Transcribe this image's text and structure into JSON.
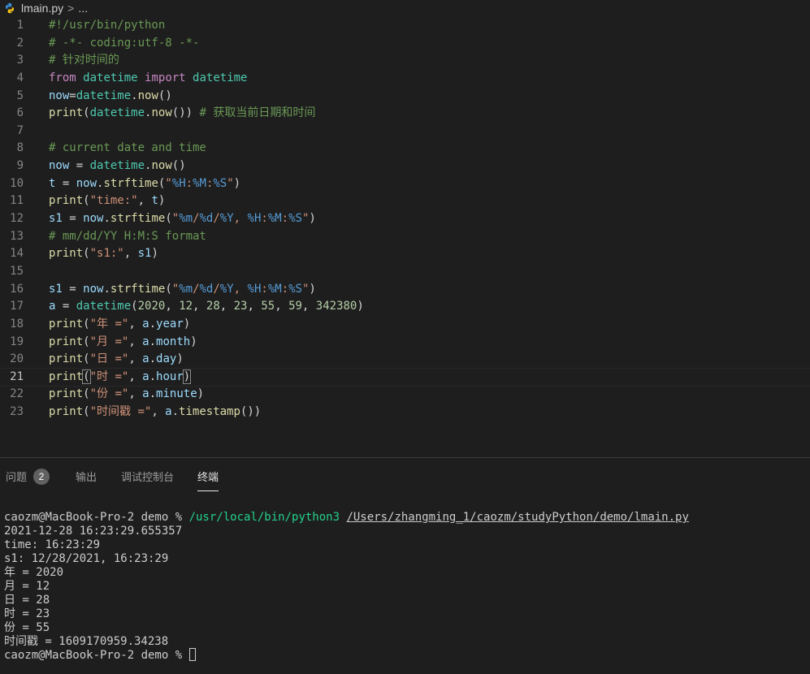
{
  "breadcrumb": {
    "file": "lmain.py",
    "separator": ">",
    "more": "..."
  },
  "editor": {
    "active_line": 21,
    "lines": [
      {
        "n": "1",
        "tokens": [
          {
            "t": "#!/usr/bin/python",
            "c": "cm"
          }
        ]
      },
      {
        "n": "2",
        "tokens": [
          {
            "t": "# -*- coding:utf-8 -*-",
            "c": "cm"
          }
        ]
      },
      {
        "n": "3",
        "tokens": [
          {
            "t": "# 针对时间的",
            "c": "cm"
          }
        ]
      },
      {
        "n": "4",
        "tokens": [
          {
            "t": "from",
            "c": "kw"
          },
          {
            "t": " ",
            "c": "pun"
          },
          {
            "t": "datetime",
            "c": "cls"
          },
          {
            "t": " ",
            "c": "pun"
          },
          {
            "t": "import",
            "c": "kw"
          },
          {
            "t": " ",
            "c": "pun"
          },
          {
            "t": "datetime",
            "c": "cls"
          }
        ]
      },
      {
        "n": "5",
        "tokens": [
          {
            "t": "now",
            "c": "var"
          },
          {
            "t": "=",
            "c": "pun"
          },
          {
            "t": "datetime",
            "c": "cls"
          },
          {
            "t": ".",
            "c": "pun"
          },
          {
            "t": "now",
            "c": "fn"
          },
          {
            "t": "()",
            "c": "pun"
          }
        ]
      },
      {
        "n": "6",
        "tokens": [
          {
            "t": "print",
            "c": "fn"
          },
          {
            "t": "(",
            "c": "pun"
          },
          {
            "t": "datetime",
            "c": "cls"
          },
          {
            "t": ".",
            "c": "pun"
          },
          {
            "t": "now",
            "c": "fn"
          },
          {
            "t": "()) ",
            "c": "pun"
          },
          {
            "t": "# 获取当前日期和时间",
            "c": "cm"
          }
        ]
      },
      {
        "n": "7",
        "tokens": []
      },
      {
        "n": "8",
        "tokens": [
          {
            "t": "# current date and time",
            "c": "cm"
          }
        ]
      },
      {
        "n": "9",
        "tokens": [
          {
            "t": "now",
            "c": "var"
          },
          {
            "t": " = ",
            "c": "pun"
          },
          {
            "t": "datetime",
            "c": "cls"
          },
          {
            "t": ".",
            "c": "pun"
          },
          {
            "t": "now",
            "c": "fn"
          },
          {
            "t": "()",
            "c": "pun"
          }
        ]
      },
      {
        "n": "10",
        "tokens": [
          {
            "t": "t",
            "c": "var"
          },
          {
            "t": " = ",
            "c": "pun"
          },
          {
            "t": "now",
            "c": "var"
          },
          {
            "t": ".",
            "c": "pun"
          },
          {
            "t": "strftime",
            "c": "fn"
          },
          {
            "t": "(",
            "c": "pun"
          },
          {
            "t": "\"",
            "c": "str"
          },
          {
            "t": "%H",
            "c": "fmt"
          },
          {
            "t": ":",
            "c": "str"
          },
          {
            "t": "%M",
            "c": "fmt"
          },
          {
            "t": ":",
            "c": "str"
          },
          {
            "t": "%S",
            "c": "fmt"
          },
          {
            "t": "\"",
            "c": "str"
          },
          {
            "t": ")",
            "c": "pun"
          }
        ]
      },
      {
        "n": "11",
        "tokens": [
          {
            "t": "print",
            "c": "fn"
          },
          {
            "t": "(",
            "c": "pun"
          },
          {
            "t": "\"time:\"",
            "c": "str"
          },
          {
            "t": ", ",
            "c": "pun"
          },
          {
            "t": "t",
            "c": "var"
          },
          {
            "t": ")",
            "c": "pun"
          }
        ]
      },
      {
        "n": "12",
        "tokens": [
          {
            "t": "s1",
            "c": "var"
          },
          {
            "t": " = ",
            "c": "pun"
          },
          {
            "t": "now",
            "c": "var"
          },
          {
            "t": ".",
            "c": "pun"
          },
          {
            "t": "strftime",
            "c": "fn"
          },
          {
            "t": "(",
            "c": "pun"
          },
          {
            "t": "\"",
            "c": "str"
          },
          {
            "t": "%m",
            "c": "fmt"
          },
          {
            "t": "/",
            "c": "str"
          },
          {
            "t": "%d",
            "c": "fmt"
          },
          {
            "t": "/",
            "c": "str"
          },
          {
            "t": "%Y",
            "c": "fmt"
          },
          {
            "t": ", ",
            "c": "str"
          },
          {
            "t": "%H",
            "c": "fmt"
          },
          {
            "t": ":",
            "c": "str"
          },
          {
            "t": "%M",
            "c": "fmt"
          },
          {
            "t": ":",
            "c": "str"
          },
          {
            "t": "%S",
            "c": "fmt"
          },
          {
            "t": "\"",
            "c": "str"
          },
          {
            "t": ")",
            "c": "pun"
          }
        ]
      },
      {
        "n": "13",
        "tokens": [
          {
            "t": "# mm/dd/YY H:M:S format",
            "c": "cm"
          }
        ]
      },
      {
        "n": "14",
        "tokens": [
          {
            "t": "print",
            "c": "fn"
          },
          {
            "t": "(",
            "c": "pun"
          },
          {
            "t": "\"s1:\"",
            "c": "str"
          },
          {
            "t": ", ",
            "c": "pun"
          },
          {
            "t": "s1",
            "c": "var"
          },
          {
            "t": ")",
            "c": "pun"
          }
        ]
      },
      {
        "n": "15",
        "tokens": []
      },
      {
        "n": "16",
        "tokens": [
          {
            "t": "s1",
            "c": "var"
          },
          {
            "t": " = ",
            "c": "pun"
          },
          {
            "t": "now",
            "c": "var"
          },
          {
            "t": ".",
            "c": "pun"
          },
          {
            "t": "strftime",
            "c": "fn"
          },
          {
            "t": "(",
            "c": "pun"
          },
          {
            "t": "\"",
            "c": "str"
          },
          {
            "t": "%m",
            "c": "fmt"
          },
          {
            "t": "/",
            "c": "str"
          },
          {
            "t": "%d",
            "c": "fmt"
          },
          {
            "t": "/",
            "c": "str"
          },
          {
            "t": "%Y",
            "c": "fmt"
          },
          {
            "t": ", ",
            "c": "str"
          },
          {
            "t": "%H",
            "c": "fmt"
          },
          {
            "t": ":",
            "c": "str"
          },
          {
            "t": "%M",
            "c": "fmt"
          },
          {
            "t": ":",
            "c": "str"
          },
          {
            "t": "%S",
            "c": "fmt"
          },
          {
            "t": "\"",
            "c": "str"
          },
          {
            "t": ")",
            "c": "pun"
          }
        ]
      },
      {
        "n": "17",
        "tokens": [
          {
            "t": "a",
            "c": "var"
          },
          {
            "t": " = ",
            "c": "pun"
          },
          {
            "t": "datetime",
            "c": "cls"
          },
          {
            "t": "(",
            "c": "pun"
          },
          {
            "t": "2020",
            "c": "num"
          },
          {
            "t": ", ",
            "c": "pun"
          },
          {
            "t": "12",
            "c": "num"
          },
          {
            "t": ", ",
            "c": "pun"
          },
          {
            "t": "28",
            "c": "num"
          },
          {
            "t": ", ",
            "c": "pun"
          },
          {
            "t": "23",
            "c": "num"
          },
          {
            "t": ", ",
            "c": "pun"
          },
          {
            "t": "55",
            "c": "num"
          },
          {
            "t": ", ",
            "c": "pun"
          },
          {
            "t": "59",
            "c": "num"
          },
          {
            "t": ", ",
            "c": "pun"
          },
          {
            "t": "342380",
            "c": "num"
          },
          {
            "t": ")",
            "c": "pun"
          }
        ]
      },
      {
        "n": "18",
        "tokens": [
          {
            "t": "print",
            "c": "fn"
          },
          {
            "t": "(",
            "c": "pun"
          },
          {
            "t": "\"年 =\"",
            "c": "str"
          },
          {
            "t": ", ",
            "c": "pun"
          },
          {
            "t": "a",
            "c": "var"
          },
          {
            "t": ".",
            "c": "pun"
          },
          {
            "t": "year",
            "c": "var"
          },
          {
            "t": ")",
            "c": "pun"
          }
        ]
      },
      {
        "n": "19",
        "tokens": [
          {
            "t": "print",
            "c": "fn"
          },
          {
            "t": "(",
            "c": "pun"
          },
          {
            "t": "\"月 =\"",
            "c": "str"
          },
          {
            "t": ", ",
            "c": "pun"
          },
          {
            "t": "a",
            "c": "var"
          },
          {
            "t": ".",
            "c": "pun"
          },
          {
            "t": "month",
            "c": "var"
          },
          {
            "t": ")",
            "c": "pun"
          }
        ]
      },
      {
        "n": "20",
        "tokens": [
          {
            "t": "print",
            "c": "fn"
          },
          {
            "t": "(",
            "c": "pun"
          },
          {
            "t": "\"日 =\"",
            "c": "str"
          },
          {
            "t": ", ",
            "c": "pun"
          },
          {
            "t": "a",
            "c": "var"
          },
          {
            "t": ".",
            "c": "pun"
          },
          {
            "t": "day",
            "c": "var"
          },
          {
            "t": ")",
            "c": "pun"
          }
        ]
      },
      {
        "n": "21",
        "tokens": [
          {
            "t": "print",
            "c": "fn"
          },
          {
            "t": "(",
            "c": "pun",
            "box": true
          },
          {
            "t": "\"时 =\"",
            "c": "str"
          },
          {
            "t": ", ",
            "c": "pun"
          },
          {
            "t": "a",
            "c": "var"
          },
          {
            "t": ".",
            "c": "pun"
          },
          {
            "t": "hour",
            "c": "var"
          },
          {
            "t": ")",
            "c": "pun",
            "box": true
          }
        ]
      },
      {
        "n": "22",
        "tokens": [
          {
            "t": "print",
            "c": "fn"
          },
          {
            "t": "(",
            "c": "pun"
          },
          {
            "t": "\"份 =\"",
            "c": "str"
          },
          {
            "t": ", ",
            "c": "pun"
          },
          {
            "t": "a",
            "c": "var"
          },
          {
            "t": ".",
            "c": "pun"
          },
          {
            "t": "minute",
            "c": "var"
          },
          {
            "t": ")",
            "c": "pun"
          }
        ]
      },
      {
        "n": "23",
        "tokens": [
          {
            "t": "print",
            "c": "fn"
          },
          {
            "t": "(",
            "c": "pun"
          },
          {
            "t": "\"时间戳 =\"",
            "c": "str"
          },
          {
            "t": ", ",
            "c": "pun"
          },
          {
            "t": "a",
            "c": "var"
          },
          {
            "t": ".",
            "c": "pun"
          },
          {
            "t": "timestamp",
            "c": "fn"
          },
          {
            "t": "())",
            "c": "pun"
          }
        ]
      }
    ]
  },
  "panel": {
    "tabs": [
      {
        "label": "问题",
        "badge": "2",
        "active": false
      },
      {
        "label": "输出",
        "active": false
      },
      {
        "label": "调试控制台",
        "active": false
      },
      {
        "label": "终端",
        "active": true
      }
    ]
  },
  "terminal": {
    "prompt": "caozm@MacBook-Pro-2 demo % ",
    "command": "/usr/local/bin/python3",
    "script_path": "/Users/zhangming_1/caozm/studyPython/demo/lmain.py",
    "output": [
      "2021-12-28 16:23:29.655357",
      "time: 16:23:29",
      "s1: 12/28/2021, 16:23:29",
      "年 = 2020",
      "月 = 12",
      "日 = 28",
      "时 = 23",
      "份 = 55",
      "时间戳 = 1609170959.34238"
    ],
    "final_prompt": "caozm@MacBook-Pro-2 demo % "
  },
  "colors": {
    "background": "#1e1e1e",
    "comment": "#6a9955",
    "keyword": "#c586c0",
    "class": "#4ec9b0",
    "variable": "#9cdcfe",
    "function": "#dcdcaa",
    "string": "#ce9178",
    "number": "#b5cea8",
    "format": "#569cd6",
    "terminal_command": "#23d18b"
  },
  "icons": {
    "file_icon": "python-icon"
  }
}
